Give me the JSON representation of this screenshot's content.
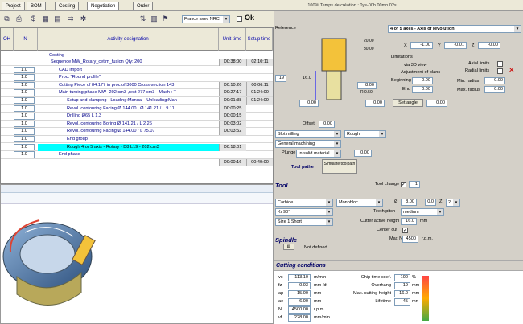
{
  "tabs": [
    "Project",
    "BOM",
    "Costing",
    "Negotiation",
    "Order"
  ],
  "titlebar": "100% Temps de création : 0ys-00h 00mn 02s",
  "toolbar": {
    "currency": "France avec NRC",
    "ok_label": "Ok"
  },
  "grid": {
    "headers": {
      "n": "N",
      "activity": "Activity designation",
      "unit": "Unit time",
      "setup": "Setup time"
    },
    "section_label": "Costing",
    "rows": [
      {
        "n": "",
        "des": "Sequence MW_Rotary_cetim_fusion  Qty: 200",
        "t1": "00:38:00",
        "t2": "02:10:11"
      },
      {
        "n": "1.0",
        "des": "CAD import",
        "t1": "",
        "t2": ""
      },
      {
        "n": "1.0",
        "des": "Proc. \"Round profile\"",
        "t1": "",
        "t2": ""
      },
      {
        "n": "1.0",
        "des": "Cutting Piece of 84.177 in proc of 3000 Cross-section 143",
        "t1": "00:10:26",
        "t2": "00:06:11"
      },
      {
        "n": "1.0",
        "des": "Main turning phase  MW -202 cm3 ,rest 277 cm3 - Mach : T",
        "t1": "00:27:17",
        "t2": "01:24:00"
      },
      {
        "n": "1.0",
        "des": "Setup and clamping - Loading:Manual - Unloading:Man",
        "t1": "00:01:38",
        "t2": "01:24:00"
      },
      {
        "n": "1.0",
        "des": "Revol. contouring  Facing  Ø 144.00 , Ø 141.21 / L 9.11",
        "t1": "00:00:25",
        "t2": ""
      },
      {
        "n": "1.0",
        "des": "Drilling Ø65 L 1.3",
        "t1": "00:00:15",
        "t2": ""
      },
      {
        "n": "1.0",
        "des": "Revol. contouring  Boring  Ø 141.21 / L 2.26",
        "t1": "00:03:02",
        "t2": ""
      },
      {
        "n": "1.0",
        "des": "Revol. contouring  Facing  Ø 144.00 / L 75.07",
        "t1": "00:03:52",
        "t2": ""
      },
      {
        "n": "1.0",
        "des": "End group",
        "t1": "",
        "t2": ""
      },
      {
        "n": "1.0",
        "des": "Rough  4 or 5 axis - Rotary - D8 L19 - 202 cm3",
        "t1": "00:18:01",
        "t2": ""
      },
      {
        "n": "1.0",
        "des": "End phase",
        "t1": "",
        "t2": ""
      },
      {
        "n": "",
        "des": "",
        "t1": "00:00:16",
        "t2": "00:40:00"
      }
    ]
  },
  "ref": {
    "label": "Reference",
    "mode": "4 or 5 axes - Axis of revolution",
    "x_label": "X",
    "x": "-1.00",
    "y_label": "Y",
    "y": "-0.01",
    "z_label": "Z",
    "z": "-0.00",
    "limitations": "Limitations",
    "via3d": "via 3D view",
    "adjust": "Adjustment of plans",
    "beginning_label": "Beginning",
    "beginning": "0.00",
    "end_label": "End",
    "end": "0.00",
    "axial": "Axial limits",
    "radial": "Radial limits",
    "minr_label": "Min. radius",
    "minr": "0.00",
    "maxr_label": "Max. radius",
    "maxr": "0.00",
    "set_angle": "Set angle",
    "angle": "0.00",
    "dim_19": "19",
    "dim_16": "16.0",
    "dim_8": "8.00",
    "dim_0a": "0.00",
    "dim_0b": "0.00",
    "dim_20": "20.00",
    "dim_30": "30.00",
    "dim_r": "R:0.50",
    "offset_label": "Offset",
    "offset": "0.00",
    "op": "Slot milling",
    "quality": "Rough",
    "mach": "General machining",
    "plunge_label": "Plunge",
    "plunge": "In solid material",
    "plunge_angle": "0.00",
    "toolpathe": "Tool pathe",
    "simulate": "Simulate toolpath"
  },
  "tool": {
    "title": "Tool",
    "change_label": "Tool change",
    "change": "1",
    "material": "Carbide",
    "type": "Monobloc",
    "dia": "8.00",
    "fq": "0.0",
    "z_label": "Z",
    "z": "2",
    "kr": "Kr 90°",
    "pitch_label": "Teeth pitch",
    "pitch": "medium",
    "size": "Size 1 Short",
    "cah_label": "Cutter active heigth",
    "cah": "16.0",
    "cah_unit": "mm",
    "center_label": "Center cut",
    "spindle": "Spindle",
    "notdef": "Not defined",
    "maxn_label": "Max N",
    "maxn": "4500",
    "maxn_unit": "r.p.m."
  },
  "cut": {
    "title": "Cutting conditions",
    "rows": [
      {
        "k": "vc",
        "v": "113.10",
        "u": "m/min"
      },
      {
        "k": "fz",
        "v": "0.03",
        "u": "mm /dt"
      },
      {
        "k": "ap",
        "v": "15.00",
        "u": "mm"
      },
      {
        "k": "ae",
        "v": "6.00",
        "u": "mm"
      },
      {
        "k": "N",
        "v": "4500.00",
        "u": "r.p.m."
      },
      {
        "k": "vf",
        "v": "228.00",
        "u": "mm/min"
      }
    ],
    "right": [
      {
        "k": "Chip time coef.",
        "v": "100",
        "u": "%"
      },
      {
        "k": "Overhang",
        "v": "19",
        "u": "mm"
      },
      {
        "k": "Max. cutting height",
        "v": "16.0",
        "u": "mm"
      },
      {
        "k": "Lifetime",
        "v": "45",
        "u": "mn"
      }
    ]
  }
}
